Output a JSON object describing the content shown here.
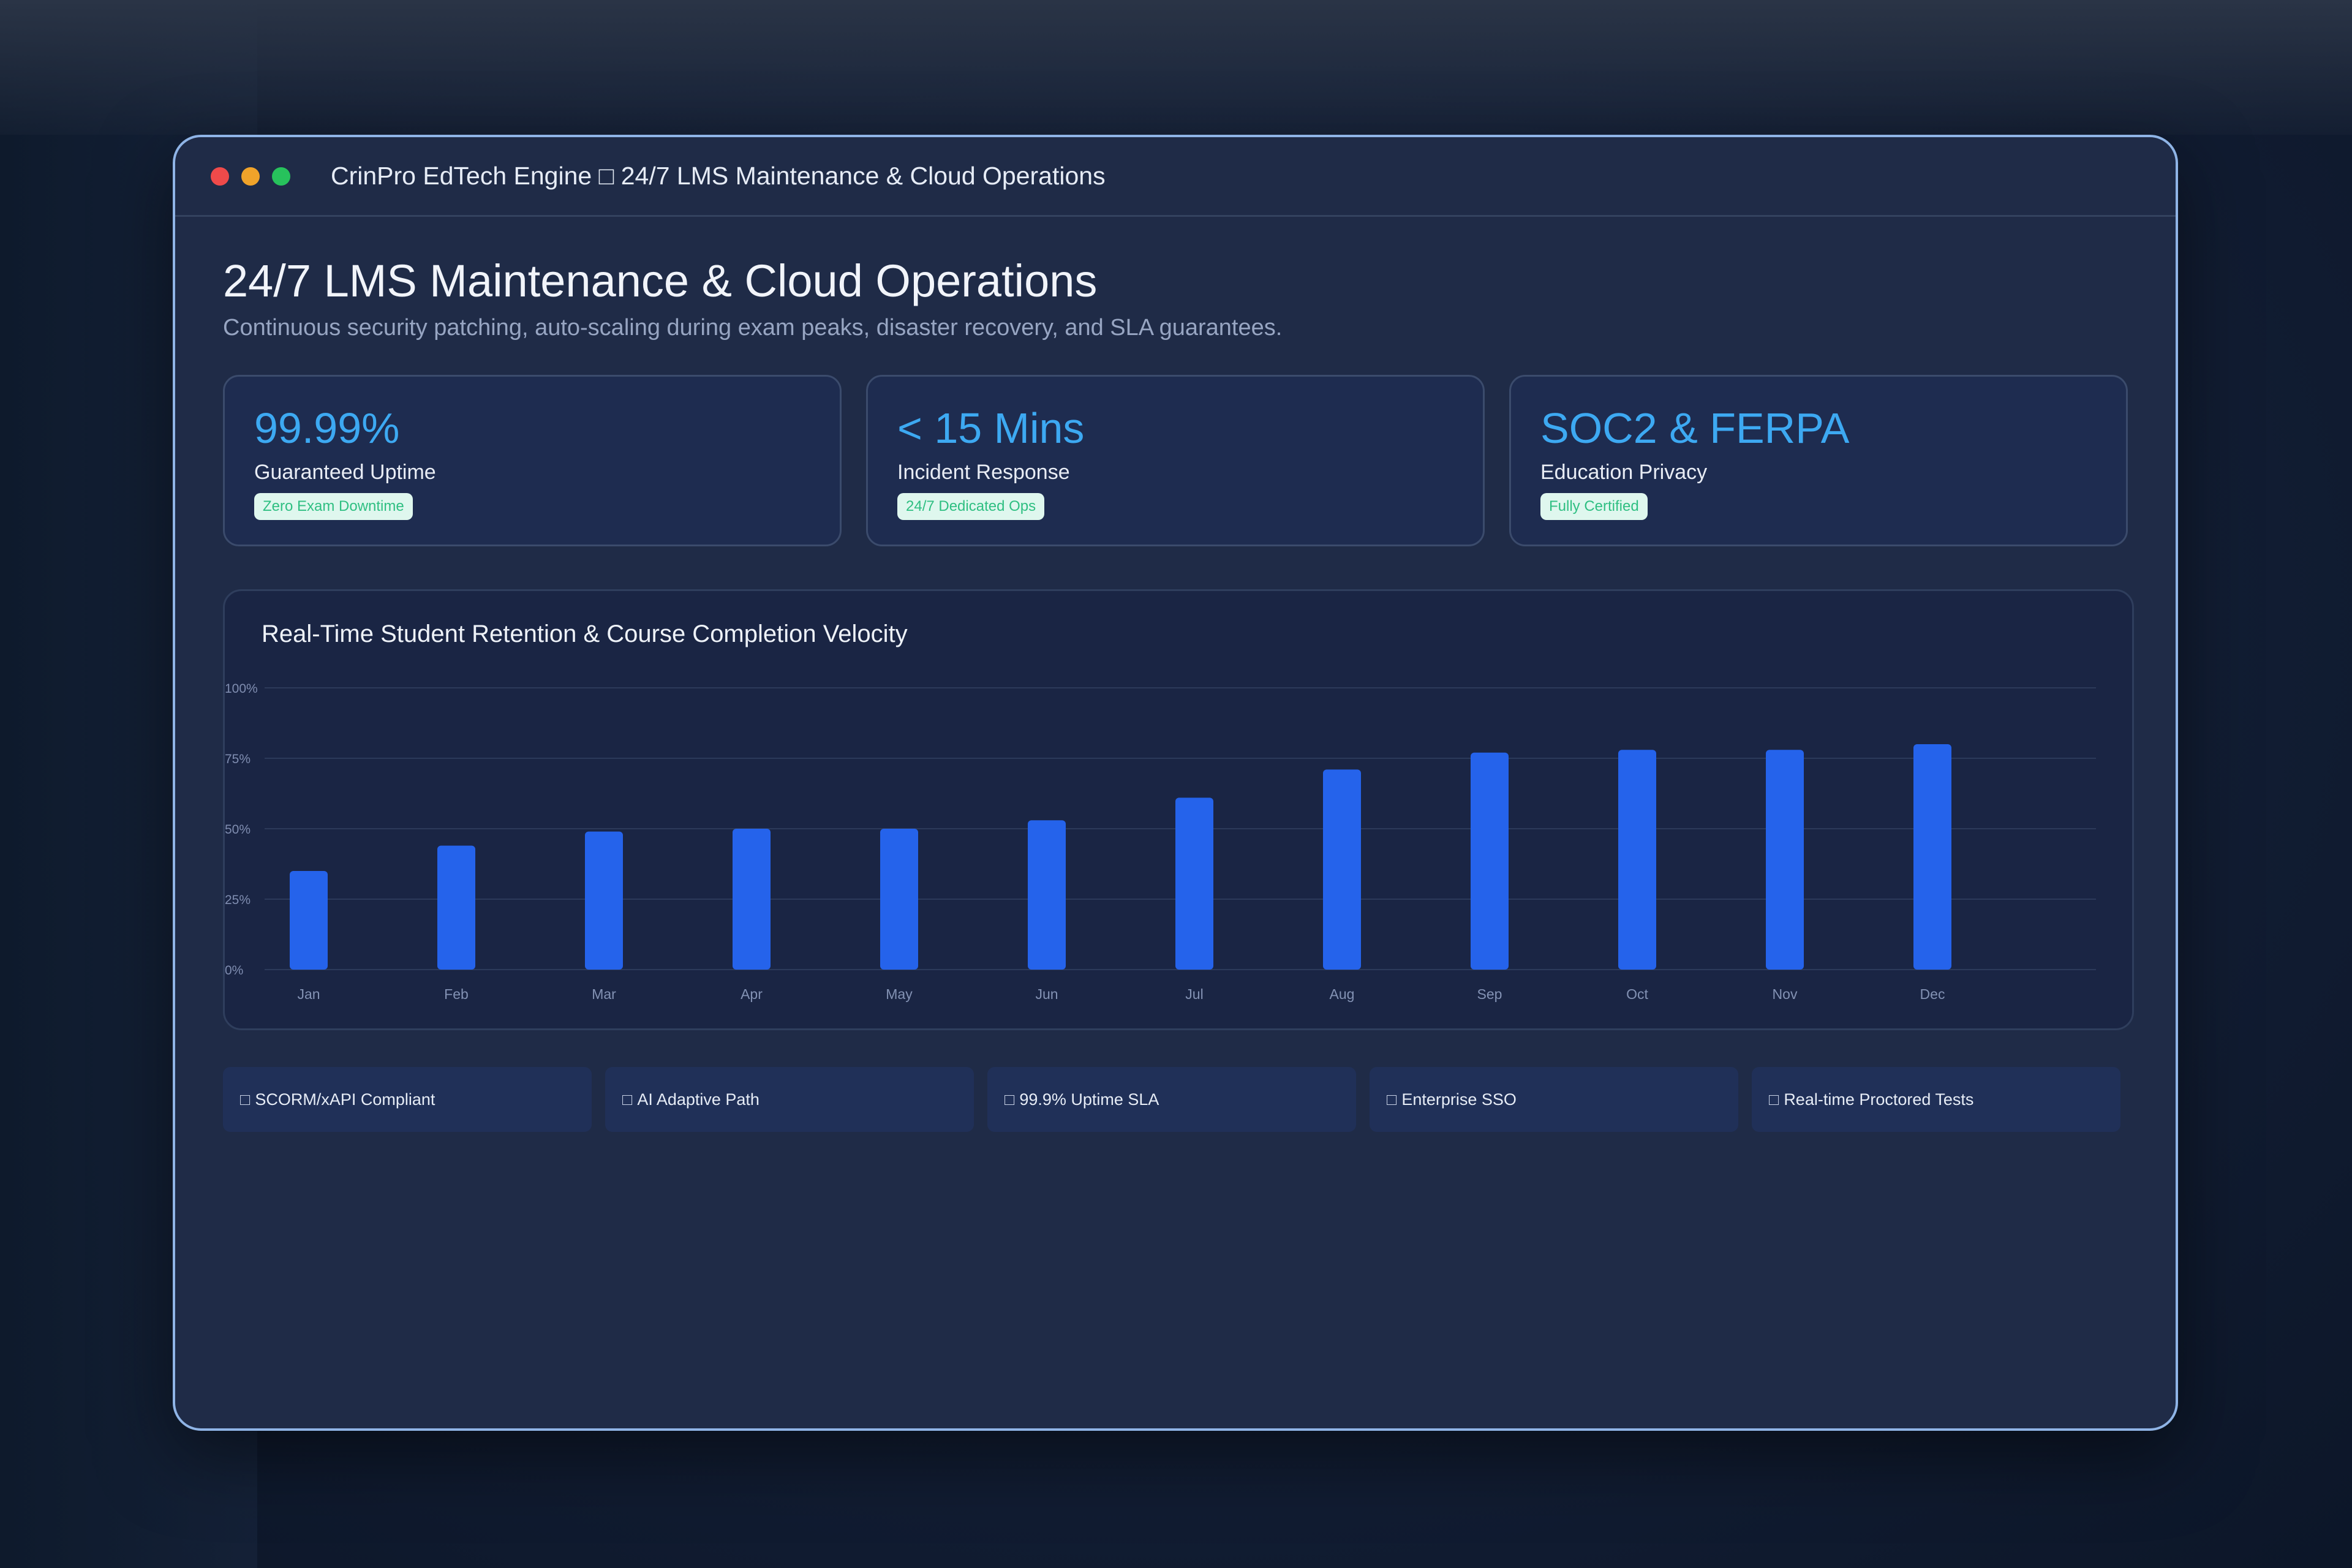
{
  "window": {
    "title": "CrinPro EdTech Engine □ 24/7 LMS Maintenance & Cloud Operations"
  },
  "header": {
    "title": "24/7 LMS Maintenance & Cloud Operations",
    "subtitle": "Continuous security patching, auto-scaling during exam peaks, disaster recovery, and SLA guarantees."
  },
  "stats": [
    {
      "value": "99.99%",
      "label": "Guaranteed Uptime",
      "badge": "Zero Exam Downtime"
    },
    {
      "value": "< 15 Mins",
      "label": "Incident Response",
      "badge": "24/7 Dedicated Ops"
    },
    {
      "value": "SOC2 & FERPA",
      "label": "Education Privacy",
      "badge": "Fully Certified"
    }
  ],
  "chart_data": {
    "type": "bar",
    "title": "Real-Time Student Retention & Course Completion Velocity",
    "categories": [
      "Jan",
      "Feb",
      "Mar",
      "Apr",
      "May",
      "Jun",
      "Jul",
      "Aug",
      "Sep",
      "Oct",
      "Nov",
      "Dec"
    ],
    "values": [
      35,
      44,
      49,
      50,
      50,
      53,
      61,
      71,
      77,
      78,
      78,
      80
    ],
    "yticks": [
      "0%",
      "25%",
      "50%",
      "75%",
      "100%"
    ],
    "ylim": [
      0,
      100
    ],
    "grid": true,
    "bar_color": "#2563eb"
  },
  "features": [
    {
      "glyph": "□",
      "label": "SCORM/xAPI Compliant"
    },
    {
      "glyph": "□",
      "label": "AI Adaptive Path"
    },
    {
      "glyph": "□",
      "label": "99.9% Uptime SLA"
    },
    {
      "glyph": "□",
      "label": "Enterprise SSO"
    },
    {
      "glyph": "□",
      "label": "Real-time Proctored Tests"
    }
  ],
  "colors": {
    "accent": "#3da9f2",
    "badge_bg": "#dff7ee",
    "badge_text": "#2fbf82",
    "window_border": "#8fb4e6"
  }
}
